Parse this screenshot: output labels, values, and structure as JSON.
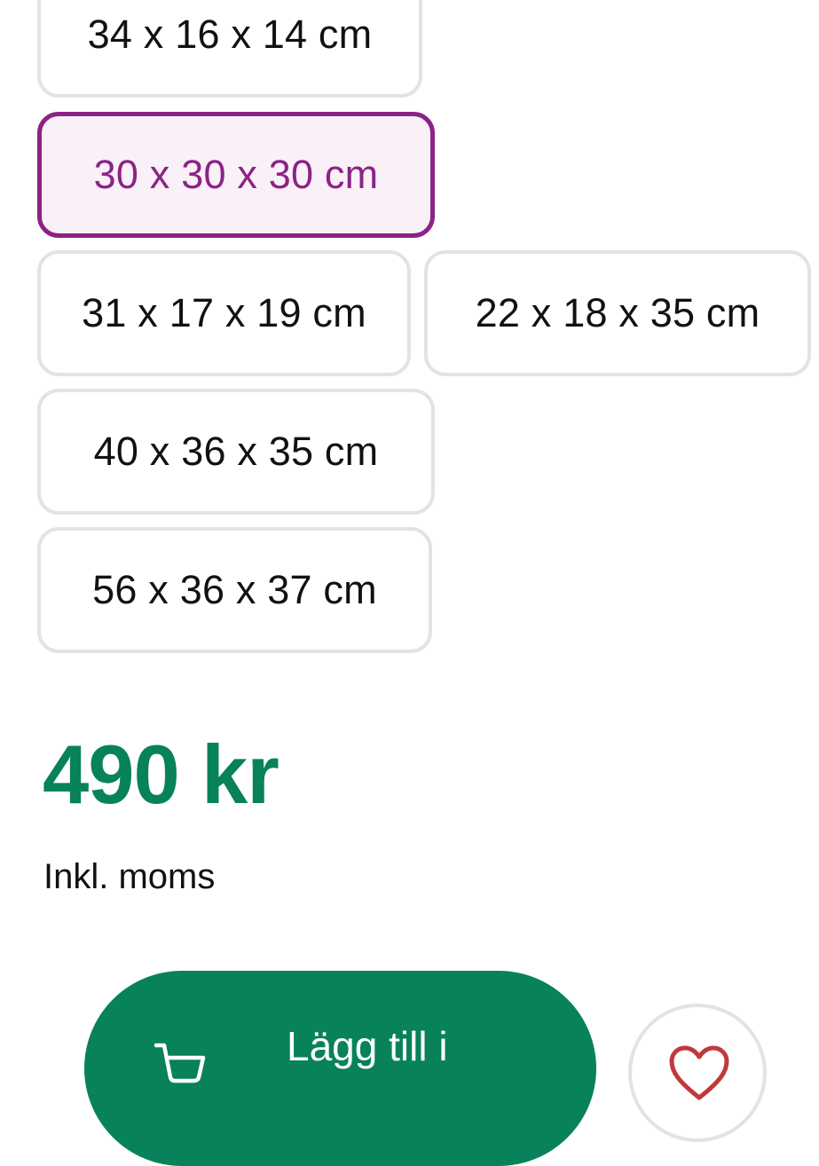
{
  "size_options": [
    {
      "label": "34 x 16 x 14 cm",
      "selected": false
    },
    {
      "label": "30 x 30 x 30 cm",
      "selected": true
    },
    {
      "label": "31 x 17 x 19 cm",
      "selected": false
    },
    {
      "label": "22 x 18 x 35 cm",
      "selected": false
    },
    {
      "label": "40 x 36 x 35 cm",
      "selected": false
    },
    {
      "label": "56 x 36 x 37 cm",
      "selected": false
    }
  ],
  "price": {
    "amount": "490 kr",
    "vat_note": "Inkl. moms"
  },
  "actions": {
    "add_to_cart_label": "Lägg till i",
    "add_to_cart_icon": "cart-icon",
    "wishlist_icon": "heart-icon"
  },
  "colors": {
    "accent_green": "#08825a",
    "selected_purple": "#8b2386",
    "selected_bg": "#faf0f8",
    "heart_red": "#c0393b"
  }
}
